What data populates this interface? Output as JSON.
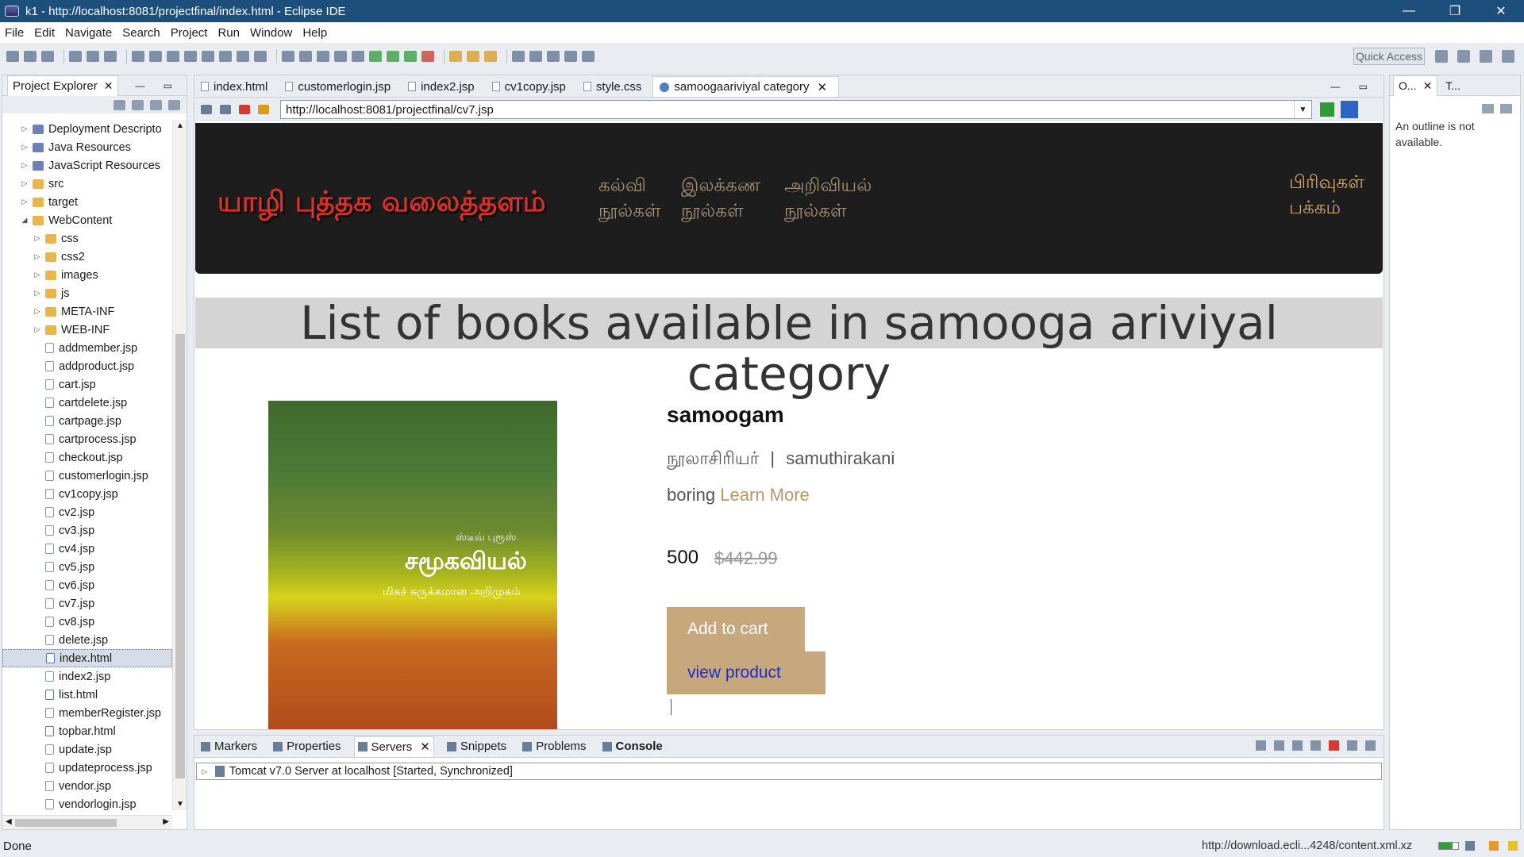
{
  "window": {
    "title": "k1 - http://localhost:8081/projectfinal/index.html - Eclipse IDE",
    "controls": [
      "—",
      "❐",
      "✕"
    ]
  },
  "menu": [
    "File",
    "Edit",
    "Navigate",
    "Search",
    "Project",
    "Run",
    "Window",
    "Help"
  ],
  "toolbar": {
    "quick_access_placeholder": "Quick Access"
  },
  "project_explorer": {
    "title": "Project Explorer",
    "close": "✕",
    "items": [
      {
        "label": "Deployment Descripto",
        "indent": 1,
        "type": "pkg",
        "twisty": "▷"
      },
      {
        "label": "Java Resources",
        "indent": 1,
        "type": "pkg",
        "twisty": "▷"
      },
      {
        "label": "JavaScript Resources",
        "indent": 1,
        "type": "pkg",
        "twisty": "▷"
      },
      {
        "label": "src",
        "indent": 1,
        "type": "folder",
        "twisty": "▷"
      },
      {
        "label": "target",
        "indent": 1,
        "type": "folder",
        "twisty": "▷"
      },
      {
        "label": "WebContent",
        "indent": 1,
        "type": "folder",
        "twisty": "◢"
      },
      {
        "label": "css",
        "indent": 2,
        "type": "folder",
        "twisty": "▷"
      },
      {
        "label": "css2",
        "indent": 2,
        "type": "folder",
        "twisty": "▷"
      },
      {
        "label": "images",
        "indent": 2,
        "type": "folder",
        "twisty": "▷"
      },
      {
        "label": "js",
        "indent": 2,
        "type": "folder",
        "twisty": "▷"
      },
      {
        "label": "META-INF",
        "indent": 2,
        "type": "folder",
        "twisty": "▷"
      },
      {
        "label": "WEB-INF",
        "indent": 2,
        "type": "folder",
        "twisty": "▷"
      },
      {
        "label": "addmember.jsp",
        "indent": 2,
        "type": "file",
        "twisty": ""
      },
      {
        "label": "addproduct.jsp",
        "indent": 2,
        "type": "file",
        "twisty": ""
      },
      {
        "label": "cart.jsp",
        "indent": 2,
        "type": "file",
        "twisty": ""
      },
      {
        "label": "cartdelete.jsp",
        "indent": 2,
        "type": "file",
        "twisty": ""
      },
      {
        "label": "cartpage.jsp",
        "indent": 2,
        "type": "file",
        "twisty": ""
      },
      {
        "label": "cartprocess.jsp",
        "indent": 2,
        "type": "file",
        "twisty": ""
      },
      {
        "label": "checkout.jsp",
        "indent": 2,
        "type": "file",
        "twisty": ""
      },
      {
        "label": "customerlogin.jsp",
        "indent": 2,
        "type": "file",
        "twisty": ""
      },
      {
        "label": "cv1copy.jsp",
        "indent": 2,
        "type": "file",
        "twisty": ""
      },
      {
        "label": "cv2.jsp",
        "indent": 2,
        "type": "file",
        "twisty": ""
      },
      {
        "label": "cv3.jsp",
        "indent": 2,
        "type": "file",
        "twisty": ""
      },
      {
        "label": "cv4.jsp",
        "indent": 2,
        "type": "file",
        "twisty": ""
      },
      {
        "label": "cv5.jsp",
        "indent": 2,
        "type": "file",
        "twisty": ""
      },
      {
        "label": "cv6.jsp",
        "indent": 2,
        "type": "file",
        "twisty": ""
      },
      {
        "label": "cv7.jsp",
        "indent": 2,
        "type": "file",
        "twisty": ""
      },
      {
        "label": "cv8.jsp",
        "indent": 2,
        "type": "file",
        "twisty": ""
      },
      {
        "label": "delete.jsp",
        "indent": 2,
        "type": "file",
        "twisty": ""
      },
      {
        "label": "index.html",
        "indent": 2,
        "type": "html",
        "twisty": "",
        "selected": true
      },
      {
        "label": "index2.jsp",
        "indent": 2,
        "type": "file",
        "twisty": ""
      },
      {
        "label": "list.html",
        "indent": 2,
        "type": "html",
        "twisty": ""
      },
      {
        "label": "memberRegister.jsp",
        "indent": 2,
        "type": "file",
        "twisty": ""
      },
      {
        "label": "topbar.html",
        "indent": 2,
        "type": "html",
        "twisty": ""
      },
      {
        "label": "update.jsp",
        "indent": 2,
        "type": "file",
        "twisty": ""
      },
      {
        "label": "updateprocess.jsp",
        "indent": 2,
        "type": "file",
        "twisty": ""
      },
      {
        "label": "vendor.jsp",
        "indent": 2,
        "type": "file",
        "twisty": ""
      },
      {
        "label": "vendorlogin.jsp",
        "indent": 2,
        "type": "file",
        "twisty": ""
      }
    ]
  },
  "editor_tabs": [
    {
      "label": "index.html",
      "active": false
    },
    {
      "label": "customerlogin.jsp",
      "active": false
    },
    {
      "label": "index2.jsp",
      "active": false
    },
    {
      "label": "cv1copy.jsp",
      "active": false
    },
    {
      "label": "style.css",
      "active": false
    },
    {
      "label": "samoogaariviyal category",
      "active": true
    }
  ],
  "browser": {
    "url": "http://localhost:8081/projectfinal/cv7.jsp",
    "site": {
      "logo": "யாழி புத்தக வலைத்தளம்",
      "nav": [
        {
          "line1": "கல்வி",
          "line2": "நூல்கள்"
        },
        {
          "line1": "இலக்கண",
          "line2": "நூல்கள்"
        },
        {
          "line1": "அறிவியல்",
          "line2": "நூல்கள்"
        }
      ],
      "nav_right": {
        "line1": "பிரிவுகள்",
        "line2": "பக்கம்"
      },
      "heading": "List of books available in samooga ariviyal category",
      "book_cover": {
        "author": "ஸ்டீவ் புரூஸ்",
        "title": "சமூகவியல்",
        "subtitle": "மிகச் சுருக்கமான அறிமுகம்",
        "colors": [
          "#3f6a2c",
          "#d7d21b",
          "#b24a1c"
        ]
      },
      "product": {
        "title": "samoogam",
        "author_label": "நூலாசிரியர்",
        "separator": "|",
        "author": "samuthirakani",
        "description": "boring",
        "learn_more": "Learn More",
        "price": "500",
        "old_price": "$442.99",
        "add_to_cart": "Add to cart",
        "view_product": "view product"
      }
    }
  },
  "outline": {
    "tab1": "O...",
    "tab2": "T...",
    "message": "An outline is not available."
  },
  "bottom_panel": {
    "tabs": [
      {
        "label": "Markers",
        "active": false
      },
      {
        "label": "Properties",
        "active": false
      },
      {
        "label": "Servers",
        "active": true
      },
      {
        "label": "Snippets",
        "active": false
      },
      {
        "label": "Problems",
        "active": false
      },
      {
        "label": "Console",
        "active": false,
        "bold": true
      }
    ],
    "server": "Tomcat v7.0 Server at localhost  [Started, Synchronized]"
  },
  "status": {
    "left": "Done",
    "right": "http://download.ecli...4248/content.xml.xz"
  },
  "accent_colors": {
    "titlebar": "#1d4f7c",
    "button": "#c7a87d",
    "link": "#b6986c"
  }
}
